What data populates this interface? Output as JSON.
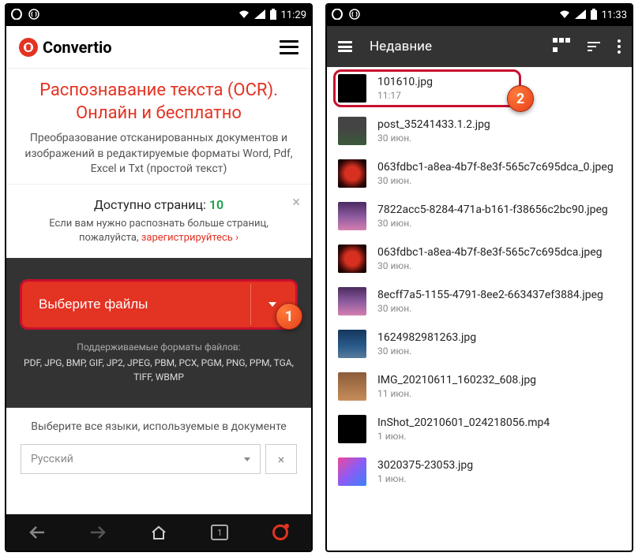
{
  "left": {
    "status": {
      "time": "11:29"
    },
    "brand": "Convertio",
    "hero": {
      "title": "Распознавание текста (OCR). Онлайн и бесплатно",
      "subtitle": "Преобразование отсканированных документов и изображений в редактируемые форматы Word, Pdf, Excel и Txt (простой текст)"
    },
    "pages": {
      "title": "Доступно страниц: ",
      "count": "10",
      "sub_pre": "Если вам нужно распознать больше страниц, пожалуйста, ",
      "register": "зарегистрируйтесь",
      "arrow": " ›"
    },
    "select_files": "Выберите файлы",
    "formats_label": "Поддерживаемые форматы файлов:",
    "formats_list": "PDF, JPG, BMP, GIF, JP2, JPEG, PBM, PCX, PGM, PNG, PPM, TGA, TIFF, WBMP",
    "lang_label": "Выберите все языки, используемые в документе",
    "lang_value": "Русский",
    "nav": {
      "tab_count": "1"
    }
  },
  "right": {
    "status": {
      "time": "11:33"
    },
    "header_title": "Недавние",
    "files": [
      {
        "name": "101610.jpg",
        "date": "11:17",
        "thumb": "black"
      },
      {
        "name": "post_35241433.1.2.jpg",
        "date": "30 июн.",
        "thumb": "green-dark"
      },
      {
        "name": "063fdbc1-a8ea-4b7f-8e3f-565c7c695dca_0.jpeg",
        "date": "30 июн.",
        "thumb": "red"
      },
      {
        "name": "7822acc5-8284-471a-b161-f38656c2bc90.jpeg",
        "date": "30 июн.",
        "thumb": "purple"
      },
      {
        "name": "063fdbc1-a8ea-4b7f-8e3f-565c7c695dca.jpeg",
        "date": "30 июн.",
        "thumb": "red"
      },
      {
        "name": "8ecff7a5-1155-4791-8ee2-663437ef3884.jpeg",
        "date": "30 июн.",
        "thumb": "purple"
      },
      {
        "name": "1624982981263.jpg",
        "date": "30 июн.",
        "thumb": "blue"
      },
      {
        "name": "IMG_20210611_160232_608.jpg",
        "date": "11 июн.",
        "thumb": "orange"
      },
      {
        "name": "InShot_20210601_024218056.mp4",
        "date": "1 июн.",
        "thumb": "black"
      },
      {
        "name": "3020375-23053.jpg",
        "date": "1 июн.",
        "thumb": "pink"
      }
    ]
  },
  "steps": {
    "s1": "1",
    "s2": "2"
  }
}
